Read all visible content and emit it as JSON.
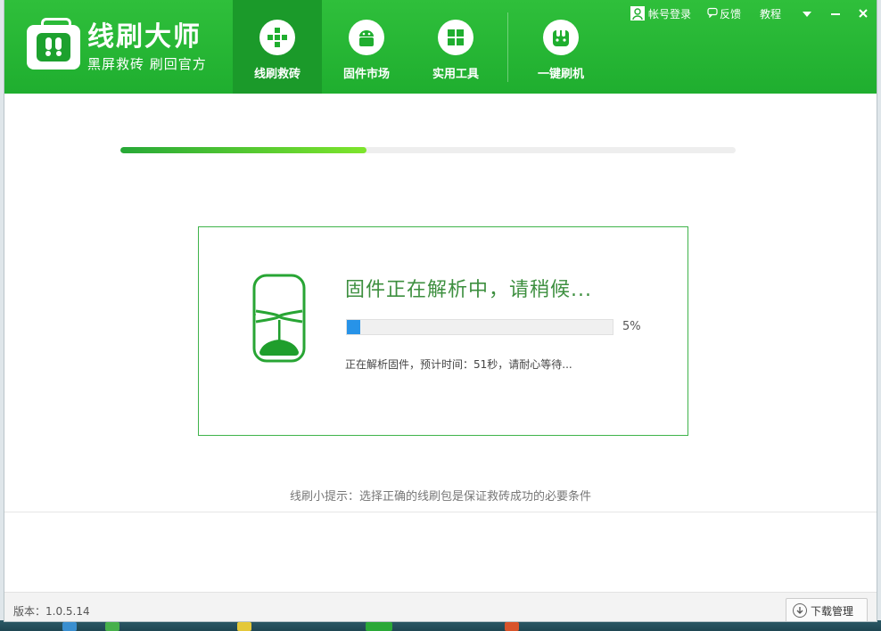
{
  "brand": {
    "title": "线刷大师",
    "subtitle": "黑屏救砖 刷回官方"
  },
  "tabs": [
    {
      "label": "线刷救砖",
      "icon": "plus-cross-icon",
      "active": true
    },
    {
      "label": "固件市场",
      "icon": "android-icon",
      "active": false
    },
    {
      "label": "实用工具",
      "icon": "grid-icon",
      "active": false
    },
    {
      "label": "一键刷机",
      "icon": "rabbit-icon",
      "active": false
    }
  ],
  "topbar": {
    "login": "帐号登录",
    "feedback": "反馈",
    "tutorial": "教程"
  },
  "main_progress": {
    "percent": 40
  },
  "task": {
    "status": "固件正在解析中，请稍候...",
    "progress_percent": 5,
    "progress_text": "5%",
    "detail": "正在解析固件，预计时间：51秒，请耐心等待..."
  },
  "tip": "线刷小提示：选择正确的线刷包是保证救砖成功的必要条件",
  "footer": {
    "version": "版本：1.0.5.14",
    "download_manager": "下载管理"
  },
  "colors": {
    "brand_green": "#1fae2f",
    "accent_blue": "#2793e8",
    "status_green": "#3d8f3f"
  }
}
